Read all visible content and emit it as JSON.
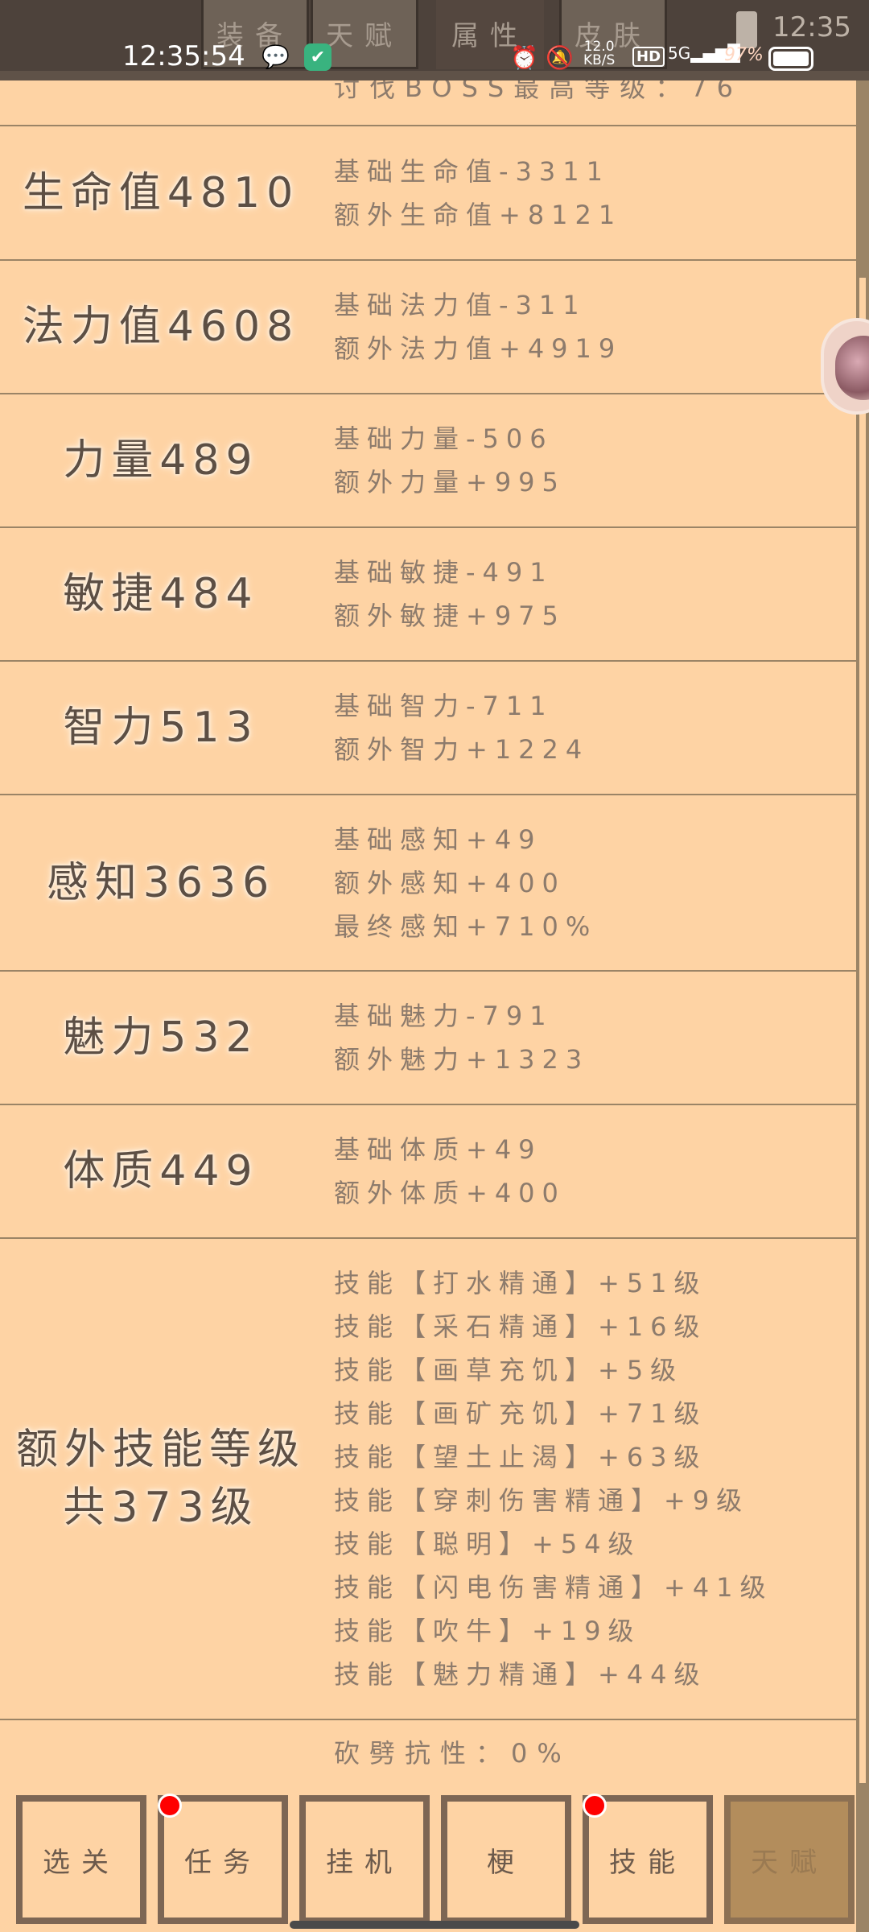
{
  "status_bar": {
    "time": "12:35:54",
    "time_right": "12:35",
    "network_speed_value": "12.0",
    "network_speed_unit": "KB/S",
    "hd_label": "HD",
    "signal_label": "5G",
    "battery_percent": "97%"
  },
  "top_tabs": [
    "装备",
    "天赋",
    "属性",
    "皮肤"
  ],
  "partial_top_line": "讨伐BOSS最高等级：76",
  "rows": [
    {
      "name": "生命值4810",
      "lines": [
        "基础生命值-3311",
        "额外生命值+8121"
      ]
    },
    {
      "name": "法力值4608",
      "lines": [
        "基础法力值-311",
        "额外法力值+4919"
      ]
    },
    {
      "name": "力量489",
      "lines": [
        "基础力量-506",
        "额外力量+995"
      ]
    },
    {
      "name": "敏捷484",
      "lines": [
        "基础敏捷-491",
        "额外敏捷+975"
      ]
    },
    {
      "name": "智力513",
      "lines": [
        "基础智力-711",
        "额外智力+1224"
      ]
    },
    {
      "name": "感知3636",
      "lines": [
        "基础感知+49",
        "额外感知+400",
        "最终感知+710%"
      ]
    },
    {
      "name": "魅力532",
      "lines": [
        "基础魅力-791",
        "额外魅力+1323"
      ]
    },
    {
      "name": "体质449",
      "lines": [
        "基础体质+49",
        "额外体质+400"
      ]
    }
  ],
  "skills_row": {
    "name_line1": "额外技能等级",
    "name_line2": "共373级",
    "lines": [
      "技能【打水精通】+51级",
      "技能【采石精通】+16级",
      "技能【画草充饥】+5级",
      "技能【画矿充饥】+71级",
      "技能【望土止渴】+63级",
      "技能【穿刺伤害精通】+9级",
      "技能【聪明】+54级",
      "技能【闪电伤害精通】+41级",
      "技能【吹牛】+19级",
      "技能【魅力精通】+44级"
    ]
  },
  "partial_bottom_line": "砍劈抗性：0%",
  "bottom_nav": {
    "buttons": [
      "选关",
      "任务",
      "挂机",
      "梗",
      "技能",
      "天赋"
    ],
    "badges": [
      false,
      true,
      false,
      false,
      true,
      false
    ],
    "disabled_index": 5
  },
  "colors": {
    "background": "#fed3a4",
    "divider": "#9b8466",
    "name_text": "#5d4f44",
    "detail_text": "#8d7b6c",
    "badge": "#ff0000"
  }
}
